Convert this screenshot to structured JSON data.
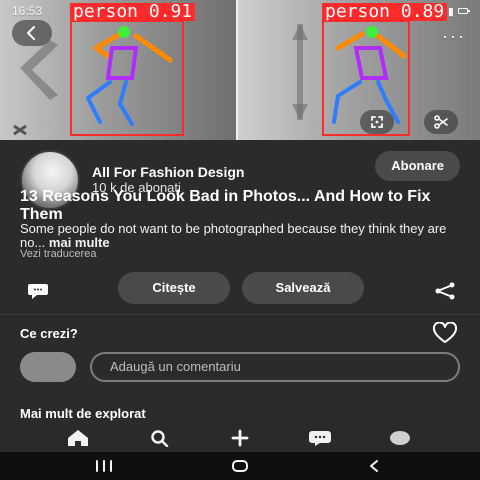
{
  "status_bar": {
    "time": "16:53"
  },
  "hero": {
    "detections": [
      {
        "label": "person",
        "score": "0.91"
      },
      {
        "label": "person",
        "score": "0.89"
      }
    ]
  },
  "pin": {
    "author_name": "All For Fashion Design",
    "author_followers": "10 k de abonați",
    "follow_label": "Abonare",
    "title": "13 Reasons You Look Bad in Photos... And How to Fix Them",
    "description": "Some people do not want to be photographed because they think they are no...",
    "more_label": "mai multe",
    "translate_label": "Vezi traducerea",
    "read_label": "Citește",
    "save_label": "Salvează"
  },
  "comments": {
    "title": "Ce crezi?",
    "placeholder": "Adaugă un comentariu"
  },
  "more": {
    "title": "Mai mult de explorat"
  },
  "icons": {
    "back": "chevron-left-icon",
    "crop": "crop-icon",
    "scissors": "scissors-icon",
    "chat": "chat-icon",
    "share": "share-icon",
    "heart": "heart-icon",
    "home": "home-icon",
    "search": "search-icon",
    "add": "plus-icon",
    "messages": "messages-icon",
    "profile": "profile-icon"
  },
  "colors": {
    "detection_red": "#ff2b2b",
    "ui_dark": "#2b2b2b",
    "pill": "#4a4a4a"
  }
}
